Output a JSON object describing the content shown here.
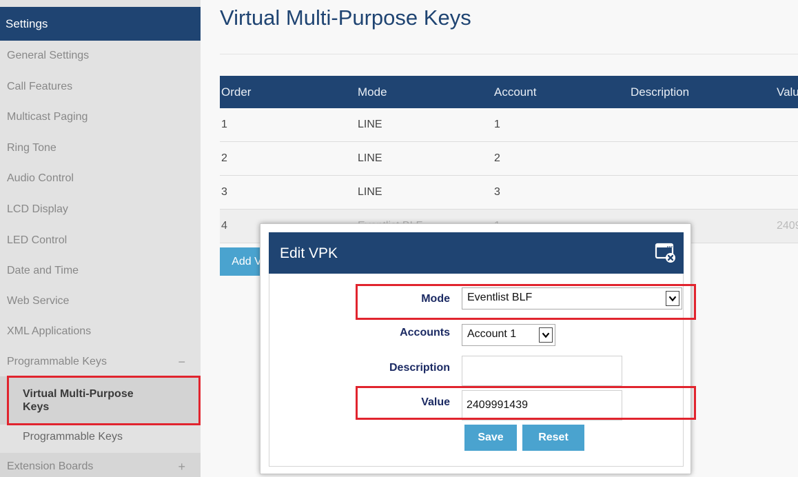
{
  "sidebar": {
    "header": "Settings",
    "items": [
      {
        "label": "General Settings"
      },
      {
        "label": "Call Features"
      },
      {
        "label": "Multicast Paging"
      },
      {
        "label": "Ring Tone"
      },
      {
        "label": "Audio Control"
      },
      {
        "label": "LCD Display"
      },
      {
        "label": "LED Control"
      },
      {
        "label": "Date and Time"
      },
      {
        "label": "Web Service"
      },
      {
        "label": "XML Applications"
      },
      {
        "label": "Programmable Keys",
        "toggle": "−"
      },
      {
        "label": "Virtual Multi-Purpose Keys",
        "active": true
      },
      {
        "label": "Programmable Keys"
      },
      {
        "label": "Extension Boards",
        "toggle": "+"
      }
    ]
  },
  "main": {
    "title": "Virtual Multi-Purpose Keys",
    "table": {
      "columns": [
        "Order",
        "Mode",
        "Account",
        "Description",
        "Value"
      ],
      "rows": [
        {
          "order": "1",
          "mode": "LINE",
          "account": "1",
          "description": "",
          "value": ""
        },
        {
          "order": "2",
          "mode": "LINE",
          "account": "2",
          "description": "",
          "value": ""
        },
        {
          "order": "3",
          "mode": "LINE",
          "account": "3",
          "description": "",
          "value": ""
        },
        {
          "order": "4",
          "mode": "Eventlist BLF",
          "account": "1",
          "description": "",
          "value": "2409"
        }
      ]
    },
    "add_button": "Add V"
  },
  "dialog": {
    "title": "Edit VPK",
    "close_icon": "close-window-icon",
    "fields": {
      "mode_label": "Mode",
      "mode_value": "Eventlist BLF",
      "accounts_label": "Accounts",
      "accounts_value": "Account 1",
      "description_label": "Description",
      "description_value": "",
      "value_label": "Value",
      "value_value": "2409991439"
    },
    "save_label": "Save",
    "reset_label": "Reset"
  },
  "colors": {
    "navy": "#1f4472",
    "button_blue": "#4aa3cf",
    "highlight_red": "#e1242e"
  }
}
